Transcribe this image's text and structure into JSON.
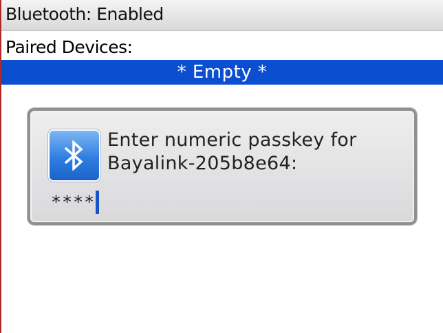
{
  "status": {
    "title": "Bluetooth: Enabled"
  },
  "paired_devices": {
    "label": "Paired Devices:",
    "items": [
      "* Empty *"
    ]
  },
  "passkey_dialog": {
    "icon": "bluetooth-icon",
    "prompt_line1": "Enter numeric passkey for",
    "prompt_line2": "Bayalink-205b8e64:",
    "passkey_value": "****"
  },
  "colors": {
    "selection": "#0b4fd0",
    "caret": "#1a53c8",
    "icon": "#2f7fe0"
  }
}
